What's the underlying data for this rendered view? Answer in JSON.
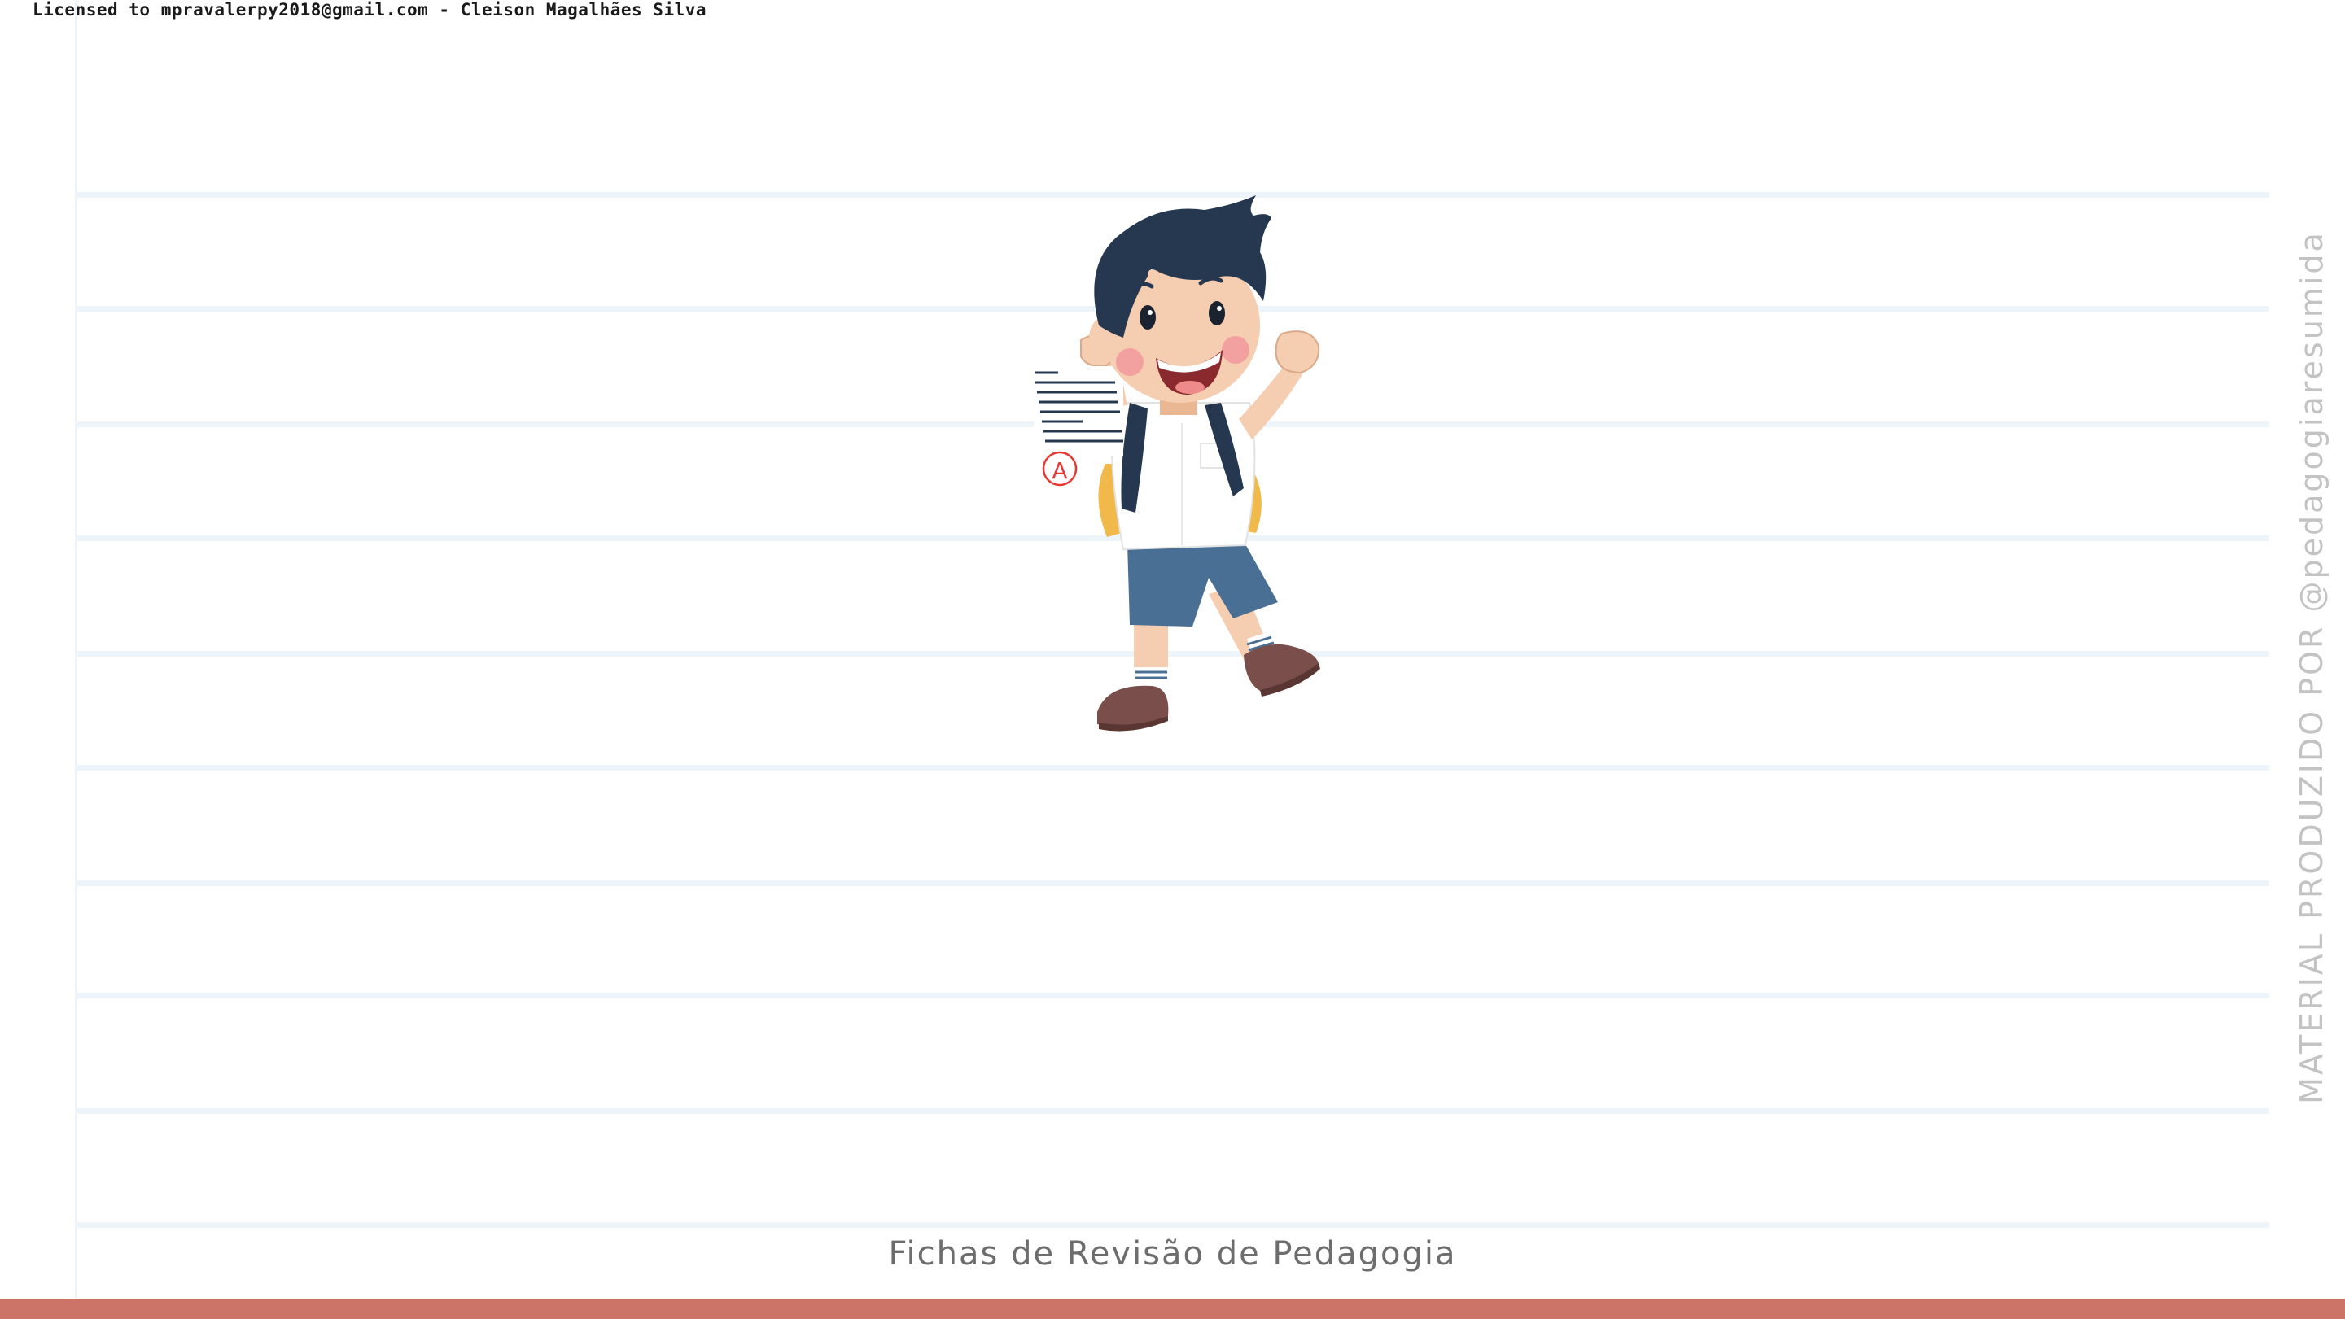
{
  "header": {
    "license_text": "Licensed to mpravalerpy2018@gmail.com - Cleison Magalhães Silva"
  },
  "illustration": {
    "icon": "student-with-graded-paper",
    "paper_grade": "A"
  },
  "sidebar": {
    "credit_text": "MATERIAL PRODUZIDO POR @pedagogiaresumida"
  },
  "footer": {
    "title": "Fichas de Revisão de Pedagogia"
  },
  "colors": {
    "accent_bar": "#cd7469",
    "ruled_line": "#edf4fa",
    "credit_text": "#c3c3c3",
    "footer_text": "#6d6d6d"
  }
}
